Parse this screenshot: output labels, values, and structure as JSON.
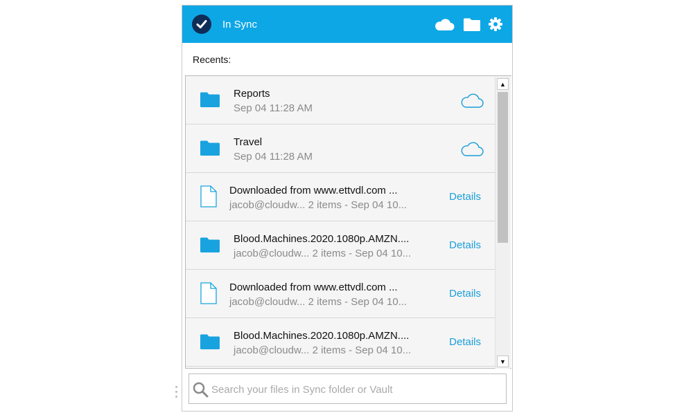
{
  "header": {
    "status_text": "In Sync",
    "status_icon": "check-circle-icon",
    "buttons": [
      {
        "name": "cloud-button",
        "icon": "cloud-icon"
      },
      {
        "name": "folder-button",
        "icon": "folder-icon"
      },
      {
        "name": "settings-button",
        "icon": "gear-icon"
      }
    ],
    "bg_color": "#0ea7e6"
  },
  "recents": {
    "label": "Recents:",
    "items": [
      {
        "title": "Reports",
        "subtitle": "Sep 04 11:28 AM",
        "type": "folder",
        "action": "cloud"
      },
      {
        "title": "Travel",
        "subtitle": "Sep 04 11:28 AM",
        "type": "folder",
        "action": "cloud"
      },
      {
        "title": "Downloaded from www.ettvdl.com ...",
        "subtitle": "jacob@cloudw... 2 items - Sep 04 10...",
        "type": "file",
        "action": "Details"
      },
      {
        "title": "Blood.Machines.2020.1080p.AMZN....",
        "subtitle": "jacob@cloudw... 2 items - Sep 04 10...",
        "type": "folder",
        "action": "Details"
      },
      {
        "title": "Downloaded from www.ettvdl.com ...",
        "subtitle": "jacob@cloudw... 2 items - Sep 04 10...",
        "type": "file",
        "action": "Details"
      },
      {
        "title": "Blood.Machines.2020.1080p.AMZN....",
        "subtitle": "jacob@cloudw... 2 items - Sep 04 10...",
        "type": "folder",
        "action": "Details"
      }
    ]
  },
  "search": {
    "placeholder": "Search your files in Sync folder or Vault",
    "value": ""
  },
  "colors": {
    "accent": "#0ea7e6",
    "link": "#1a9fd9",
    "folder": "#18a3e0",
    "status_circle": "#0e2d57"
  }
}
